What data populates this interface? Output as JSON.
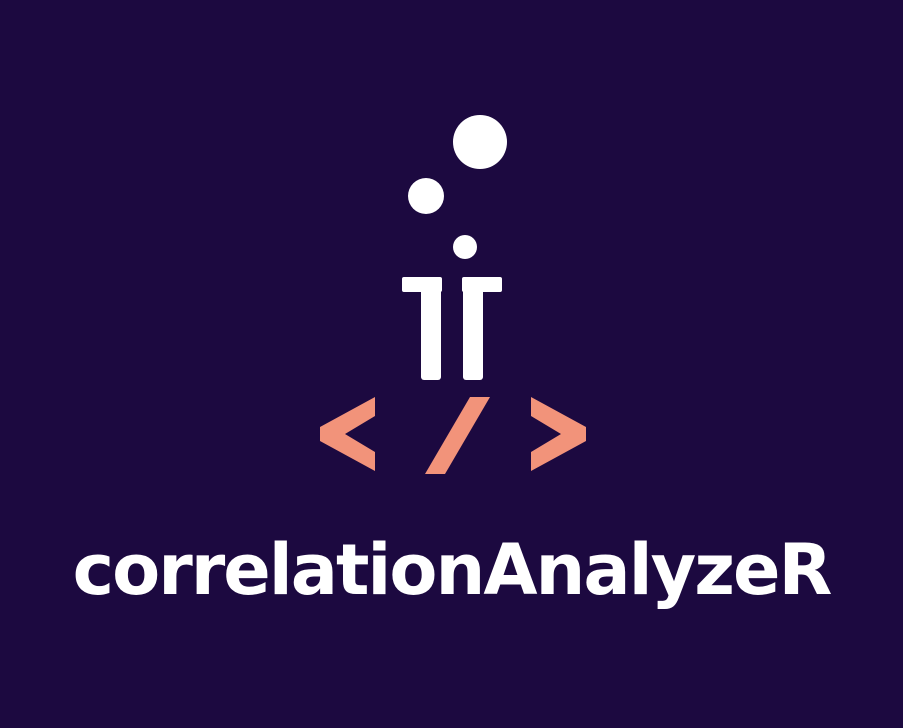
{
  "brand": {
    "name": "correlationAnalyzeR"
  },
  "colors": {
    "background": "#1c0940",
    "primary": "#ffffff",
    "accent": "#f2937a"
  },
  "icons": {
    "logo": "flask-bubbles-code-icon"
  }
}
